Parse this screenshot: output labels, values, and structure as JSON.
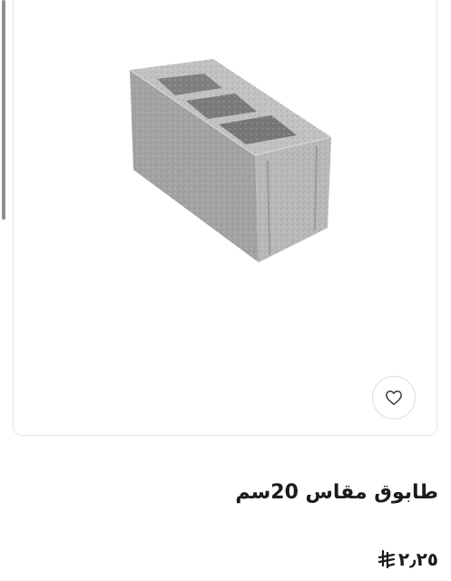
{
  "product": {
    "title": "طابوق مقاس 20سم",
    "price": "٢٫٢٥",
    "currency_icon": "saudi-riyal-icon",
    "image_subject": "concrete-block-image",
    "wishlist_icon": "heart-icon"
  },
  "colors": {
    "text": "#1c1c1e",
    "border": "#e6e6e6",
    "block_gray": "#9a9a9a"
  }
}
